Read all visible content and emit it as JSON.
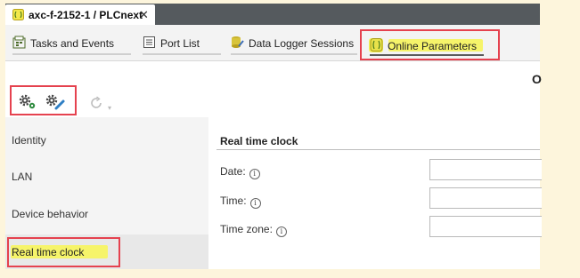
{
  "window": {
    "tab_title": "axc-f-2152-1 / PLCnext",
    "tab_icon": "plc-device-icon",
    "close_glyph": "✕"
  },
  "view_tabs": [
    {
      "label": "Tasks and Events",
      "icon": "tasks-events-icon"
    },
    {
      "label": "Port List",
      "icon": "port-list-icon"
    },
    {
      "label": "Data Logger Sessions",
      "icon": "data-logger-icon"
    },
    {
      "label": "Online Parameters",
      "icon": "online-parameters-icon",
      "active": true
    }
  ],
  "page_heading_cut": "O",
  "toolbar": {
    "buttons": [
      "settings-view-icon",
      "settings-edit-icon",
      "refresh-icon"
    ]
  },
  "sidebar": {
    "items": [
      {
        "label": "Identity"
      },
      {
        "label": "LAN"
      },
      {
        "label": "Device behavior"
      },
      {
        "label": "Real time clock",
        "active": true
      }
    ]
  },
  "content": {
    "section_title": "Real time clock",
    "fields": [
      {
        "label": "Date:",
        "info_glyph": "i",
        "value": ""
      },
      {
        "label": "Time:",
        "info_glyph": "i",
        "value": ""
      },
      {
        "label": "Time zone:",
        "info_glyph": "i",
        "value": ""
      }
    ]
  },
  "colors": {
    "highlight_box": "#e5424f",
    "highlight_marker": "#f6f46a",
    "titlebar": "#555a5e",
    "background": "#fdf5dc"
  }
}
